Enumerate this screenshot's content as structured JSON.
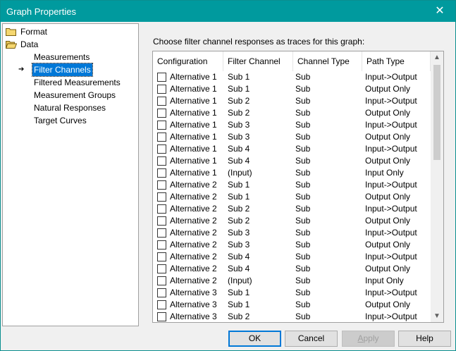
{
  "window": {
    "title": "Graph Properties",
    "close_glyph": "✕"
  },
  "tree": {
    "items": [
      {
        "label": "Format",
        "type": "folder",
        "level": 0
      },
      {
        "label": "Data",
        "type": "folder-open",
        "level": 0
      },
      {
        "label": "Measurements",
        "level": 1
      },
      {
        "label": "Filter Channels",
        "level": 1,
        "selected": true
      },
      {
        "label": "Filtered Measurements",
        "level": 1
      },
      {
        "label": "Measurement Groups",
        "level": 1
      },
      {
        "label": "Natural Responses",
        "level": 1
      },
      {
        "label": "Target Curves",
        "level": 1
      }
    ]
  },
  "prompt": "Choose filter channel responses as traces for this graph:",
  "table": {
    "columns": [
      "Configuration",
      "Filter Channel",
      "Channel Type",
      "Path Type"
    ],
    "rows": [
      [
        "Alternative 1",
        "Sub 1",
        "Sub",
        "Input->Output"
      ],
      [
        "Alternative 1",
        "Sub 1",
        "Sub",
        "Output Only"
      ],
      [
        "Alternative 1",
        "Sub 2",
        "Sub",
        "Input->Output"
      ],
      [
        "Alternative 1",
        "Sub 2",
        "Sub",
        "Output Only"
      ],
      [
        "Alternative 1",
        "Sub 3",
        "Sub",
        "Input->Output"
      ],
      [
        "Alternative 1",
        "Sub 3",
        "Sub",
        "Output Only"
      ],
      [
        "Alternative 1",
        "Sub 4",
        "Sub",
        "Input->Output"
      ],
      [
        "Alternative 1",
        "Sub 4",
        "Sub",
        "Output Only"
      ],
      [
        "Alternative 1",
        "(Input)",
        "Sub",
        "Input Only"
      ],
      [
        "Alternative 2",
        "Sub 1",
        "Sub",
        "Input->Output"
      ],
      [
        "Alternative 2",
        "Sub 1",
        "Sub",
        "Output Only"
      ],
      [
        "Alternative 2",
        "Sub 2",
        "Sub",
        "Input->Output"
      ],
      [
        "Alternative 2",
        "Sub 2",
        "Sub",
        "Output Only"
      ],
      [
        "Alternative 2",
        "Sub 3",
        "Sub",
        "Input->Output"
      ],
      [
        "Alternative 2",
        "Sub 3",
        "Sub",
        "Output Only"
      ],
      [
        "Alternative 2",
        "Sub 4",
        "Sub",
        "Input->Output"
      ],
      [
        "Alternative 2",
        "Sub 4",
        "Sub",
        "Output Only"
      ],
      [
        "Alternative 2",
        "(Input)",
        "Sub",
        "Input Only"
      ],
      [
        "Alternative 3",
        "Sub 1",
        "Sub",
        "Input->Output"
      ],
      [
        "Alternative 3",
        "Sub 1",
        "Sub",
        "Output Only"
      ],
      [
        "Alternative 3",
        "Sub 2",
        "Sub",
        "Input->Output"
      ]
    ]
  },
  "buttons": {
    "ok": "OK",
    "cancel": "Cancel",
    "apply": "Apply",
    "help": "Help"
  },
  "colors": {
    "titlebar": "#009a9e",
    "selection": "#0078d7"
  }
}
